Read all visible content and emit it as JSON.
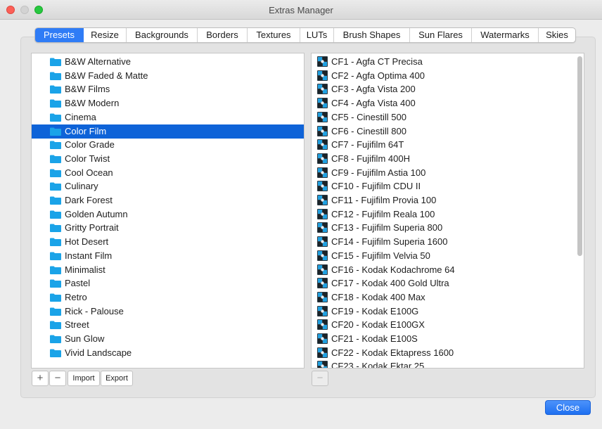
{
  "window": {
    "title": "Extras Manager"
  },
  "tabs": [
    {
      "label": "Presets",
      "active": true
    },
    {
      "label": "Resize"
    },
    {
      "label": "Backgrounds"
    },
    {
      "label": "Borders"
    },
    {
      "label": "Textures"
    },
    {
      "label": "LUTs"
    },
    {
      "label": "Brush Shapes"
    },
    {
      "label": "Sun Flares"
    },
    {
      "label": "Watermarks"
    },
    {
      "label": "Skies"
    }
  ],
  "categories": {
    "selected_index": 5,
    "items": [
      "B&W Alternative",
      "B&W Faded & Matte",
      "B&W Films",
      "B&W Modern",
      "Cinema",
      "Color Film",
      "Color Grade",
      "Color Twist",
      "Cool Ocean",
      "Culinary",
      "Dark Forest",
      "Golden Autumn",
      "Gritty Portrait",
      "Hot Desert",
      "Instant Film",
      "Minimalist",
      "Pastel",
      "Retro",
      "Rick - Palouse",
      "Street",
      "Sun Glow",
      "Vivid Landscape"
    ]
  },
  "presets": {
    "items": [
      "CF1 - Agfa CT Precisa",
      "CF2 - Agfa Optima 400",
      "CF3 - Agfa Vista 200",
      "CF4 - Agfa Vista 400",
      "CF5 - Cinestill 500",
      "CF6 - Cinestill 800",
      "CF7 - Fujifilm 64T",
      "CF8 - Fujifilm 400H",
      "CF9 - Fujifilm Astia 100",
      "CF10 - Fujifilm CDU II",
      "CF11 - Fujifilm Provia 100",
      "CF12 - Fujifilm Reala 100",
      "CF13 - Fujifilm Superia 800",
      "CF14 - Fujifilm Superia 1600",
      "CF15 - Fujifilm Velvia 50",
      "CF16 - Kodak Kodachrome 64",
      "CF17 - Kodak 400 Gold Ultra",
      "CF18 - Kodak 400 Max",
      "CF19 - Kodak E100G",
      "CF20 - Kodak E100GX",
      "CF21 - Kodak E100S",
      "CF22 - Kodak Ektapress 1600",
      "CF23 - Kodak Ektar 25"
    ]
  },
  "left_buttons": {
    "add": "+",
    "remove": "−",
    "import": "Import",
    "export": "Export"
  },
  "right_buttons": {
    "remove": "−"
  },
  "footer": {
    "close": "Close"
  },
  "colors": {
    "accent": "#2f7cf6",
    "selection": "#0e63d8",
    "folder": "#1aa3e8"
  },
  "icons": {
    "category": "folder-icon",
    "preset": "preset-file-icon"
  }
}
